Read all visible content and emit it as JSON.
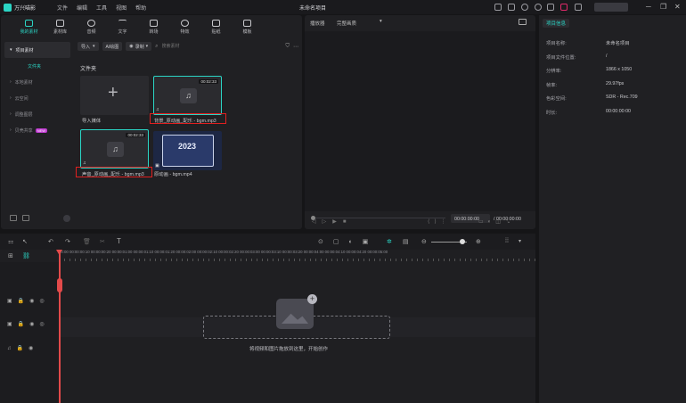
{
  "titlebar": {
    "app_name": "万兴喵影",
    "menus": [
      "文件",
      "编辑",
      "工具",
      "视图",
      "帮助"
    ],
    "document_title": "未命名项目",
    "login_label": "登录",
    "controls": [
      "minimize-icon",
      "maximize-icon",
      "close-icon"
    ]
  },
  "media": {
    "tabs": [
      {
        "label": "我的素材",
        "icon": "media-icon",
        "active": true
      },
      {
        "label": "素材库",
        "icon": "stock-icon",
        "active": false
      },
      {
        "label": "音频",
        "icon": "music-icon",
        "active": false
      },
      {
        "label": "文字",
        "icon": "text-icon",
        "active": false
      },
      {
        "label": "转场",
        "icon": "transition-icon",
        "active": false
      },
      {
        "label": "特效",
        "icon": "effects-icon",
        "active": false
      },
      {
        "label": "贴纸",
        "icon": "sticker-icon",
        "active": false
      },
      {
        "label": "模板",
        "icon": "template-icon",
        "active": false
      }
    ],
    "sidebar": {
      "items": [
        {
          "label": "项目素材",
          "active": true
        },
        {
          "label": "文件夹",
          "sub": true
        },
        {
          "label": "本地素材"
        },
        {
          "label": "云空间"
        },
        {
          "label": "调整图层"
        },
        {
          "label": "贝壳共享",
          "badge": "NEW"
        }
      ]
    },
    "toolbar": {
      "import_label": "导入",
      "ai_label": "AI绘图",
      "record_label": "录制",
      "search_placeholder": "搜索素材"
    },
    "folder_title": "文件夹",
    "clips": [
      {
        "label": "导入媒体",
        "type": "import"
      },
      {
        "label": "背景_原动画_配乐 - bgm.mp3",
        "duration": "00:02:33",
        "type": "audio"
      },
      {
        "label": "声音_原动画_配乐 - bgm.mp3",
        "duration": "00:02:33",
        "type": "audio"
      },
      {
        "label": "原动画 - bgm.mp4",
        "duration": "",
        "type": "video",
        "thumb_text": "2023"
      }
    ]
  },
  "preview": {
    "player_label": "播放器",
    "quality_label": "完整画质",
    "current_time": "00:00:00:00",
    "total_time": "/ 00:00:00:00"
  },
  "info": {
    "tab_label": "项目信息",
    "rows": [
      {
        "key": "项目名称:",
        "value": "未命名项目"
      },
      {
        "key": "项目文件位置:",
        "value": "/"
      },
      {
        "key": "分辨率:",
        "value": "1866 x 1050"
      },
      {
        "key": "帧率:",
        "value": "29.97fps"
      },
      {
        "key": "色彩空间:",
        "value": "SDR - Rec.709"
      },
      {
        "key": "时长:",
        "value": "00:00:00:00"
      }
    ]
  },
  "timeline": {
    "ruler_text": "00:00 00:00:00:10 00:00:00:20 00:00:01:00 00:00:01:10 00:00:01:20 00:00:02:00 00:00:02:10 00:00:02:20 00:00:03:00 00:00:03:10 00:00:03:20 00:00:04:00 00:00:04:10 00:00:04:20 00:00:05:00",
    "drop_text": "将视频和图片拖放到这里，开始创作"
  }
}
